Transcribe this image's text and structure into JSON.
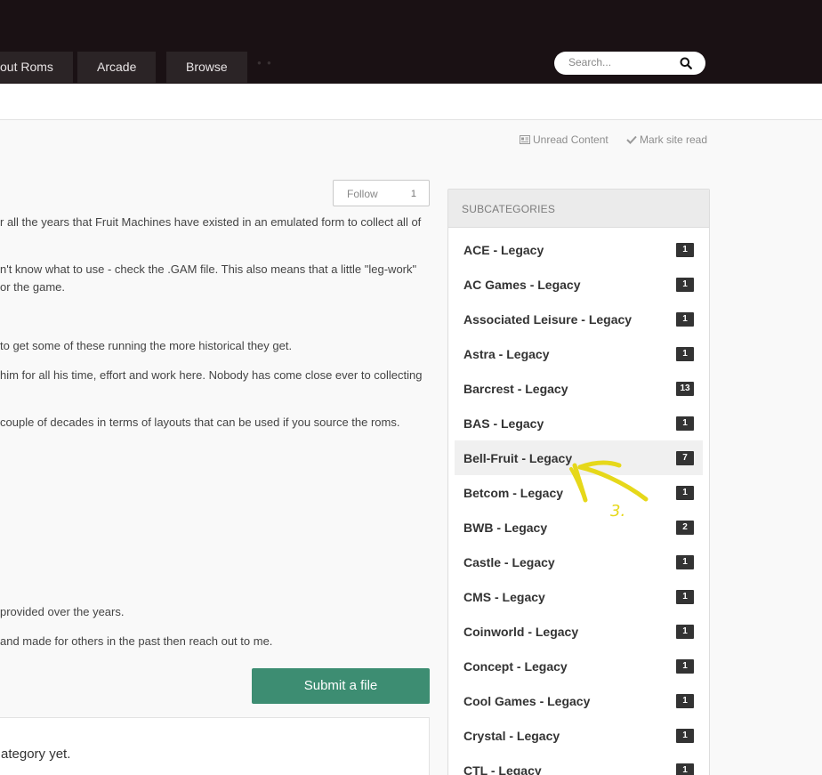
{
  "nav": {
    "items": [
      {
        "label": "out Roms"
      },
      {
        "label": "Arcade"
      },
      {
        "label": "Browse"
      }
    ]
  },
  "search": {
    "placeholder": "Search..."
  },
  "utility": {
    "unread": "Unread Content",
    "mark_read": "Mark site read"
  },
  "follow": {
    "label": "Follow",
    "count": "1"
  },
  "description": [
    "r all the years that Fruit Machines have existed in an emulated form to collect all of",
    "n't know what to use - check the .GAM file.  This also means that a little \"leg-work\"",
    "or the game.",
    "to get some of these running the more historical they get.",
    "him for all his time, effort and work here.  Nobody has come close ever to collecting",
    "couple of decades in terms of layouts that can be used if you source the roms.",
    "provided over the years.",
    "and made for others in the past then reach out to me."
  ],
  "submit_label": "Submit a file",
  "empty_text": "ategory yet.",
  "sidebar": {
    "title": "SUBCATEGORIES",
    "items": [
      {
        "label": "ACE - Legacy",
        "count": "1"
      },
      {
        "label": "AC Games - Legacy",
        "count": "1"
      },
      {
        "label": "Associated Leisure - Legacy",
        "count": "1"
      },
      {
        "label": "Astra - Legacy",
        "count": "1"
      },
      {
        "label": "Barcrest - Legacy",
        "count": "13"
      },
      {
        "label": "BAS - Legacy",
        "count": "1"
      },
      {
        "label": "Bell-Fruit - Legacy",
        "count": "7"
      },
      {
        "label": "Betcom - Legacy",
        "count": "1"
      },
      {
        "label": "BWB - Legacy",
        "count": "2"
      },
      {
        "label": "Castle - Legacy",
        "count": "1"
      },
      {
        "label": "CMS - Legacy",
        "count": "1"
      },
      {
        "label": "Coinworld - Legacy",
        "count": "1"
      },
      {
        "label": "Concept - Legacy",
        "count": "1"
      },
      {
        "label": "Cool Games - Legacy",
        "count": "1"
      },
      {
        "label": "Crystal - Legacy",
        "count": "1"
      },
      {
        "label": "CTL - Legacy",
        "count": "1"
      }
    ]
  },
  "annotation": {
    "label": "3."
  },
  "colors": {
    "topbar": "#1a1114",
    "nav_item": "#2b2426",
    "submit": "#3d8d72",
    "badge": "#333333",
    "annotation": "#e6d81a"
  }
}
